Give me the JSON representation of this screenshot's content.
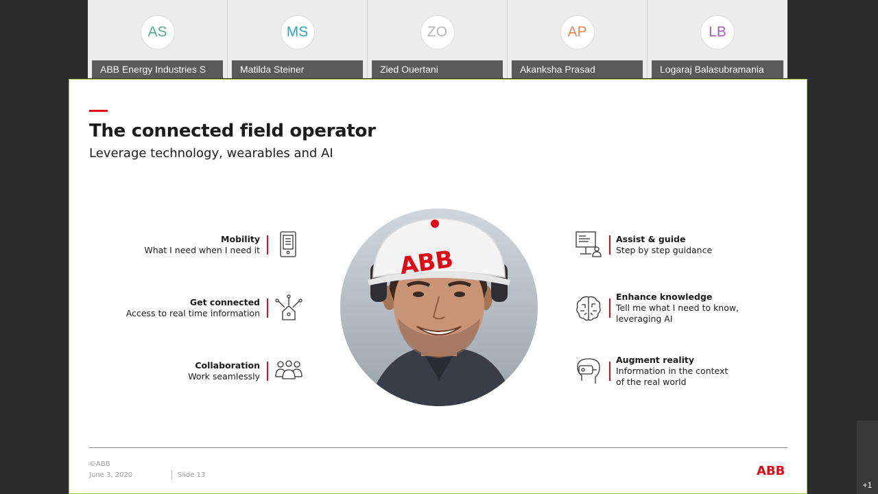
{
  "participants": [
    {
      "initials": "AS",
      "name": "ABB Energy Industries S",
      "color": "#4caf8f"
    },
    {
      "initials": "MS",
      "name": "Matilda Steiner",
      "color": "#2aa5c6"
    },
    {
      "initials": "ZO",
      "name": "Zied Ouertani",
      "color": "#b5b5b5"
    },
    {
      "initials": "AP",
      "name": "Akanksha Prasad",
      "color": "#ee8452"
    },
    {
      "initials": "LB",
      "name": "Logaraj Balasubramania",
      "color": "#a35fb5"
    }
  ],
  "slide": {
    "title": "The connected field operator",
    "subtitle": "Leverage technology, wearables and AI",
    "left_features": [
      {
        "title": "Mobility",
        "desc": "What I need when I need it",
        "icon": "mobile-device-icon"
      },
      {
        "title": "Get connected",
        "desc": "Access to real time information",
        "icon": "connected-home-icon"
      },
      {
        "title": "Collaboration",
        "desc": "Work seamlessly",
        "icon": "team-icon"
      }
    ],
    "right_features": [
      {
        "title": "Assist & guide",
        "desc": "Step by step guidance",
        "icon": "presentation-guide-icon"
      },
      {
        "title": "Enhance knowledge",
        "desc": "Tell me what I need to know,",
        "desc2": "leveraging AI",
        "icon": "brain-icon"
      },
      {
        "title": "Augment reality",
        "desc": "Information in the context",
        "desc2": "of the real world",
        "icon": "vr-headset-icon"
      }
    ],
    "photo_helmet_text": "ABB",
    "footer": {
      "copyright": "©ABB",
      "date": "June 3, 2020",
      "slide": "Slide 13",
      "logo": "ABB"
    },
    "accent_color": "#e30613"
  },
  "overflow_count": "+1"
}
